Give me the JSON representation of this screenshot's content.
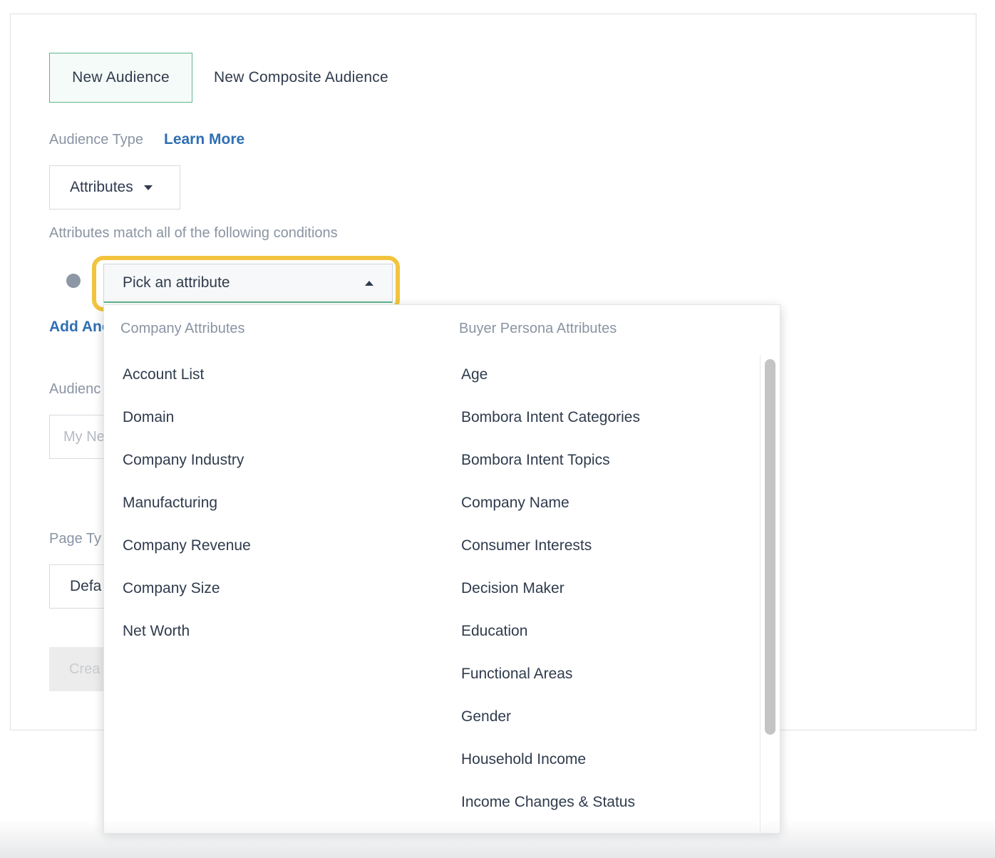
{
  "tabs": {
    "active": "New Audience",
    "inactive": "New Composite Audience"
  },
  "audience_type": {
    "label": "Audience Type",
    "learn_more": "Learn More",
    "selected": "Attributes"
  },
  "conditions_label": "Attributes match all of the following conditions",
  "attribute_picker": {
    "placeholder": "Pick an attribute"
  },
  "add_another_link": "Add Ano",
  "audience_name_label": "Audienc",
  "audience_name_placeholder": "My Ne",
  "page_type_label": "Page Ty",
  "page_type_value": "Defa",
  "create_button": "Crea",
  "dropdown": {
    "company_header": "Company Attributes",
    "buyer_header": "Buyer Persona Attributes",
    "company_items": [
      "Account List",
      "Domain",
      "Company Industry",
      "Manufacturing",
      "Company Revenue",
      "Company Size",
      "Net Worth"
    ],
    "buyer_items": [
      "Age",
      "Bombora Intent Categories",
      "Bombora Intent Topics",
      "Company Name",
      "Consumer Interests",
      "Decision Maker",
      "Education",
      "Functional Areas",
      "Gender",
      "Household Income",
      "Income Changes & Status"
    ]
  },
  "colors": {
    "accent_green": "#5fb58c",
    "highlight_yellow": "#f2c43d",
    "link_blue": "#2f6fb4"
  }
}
